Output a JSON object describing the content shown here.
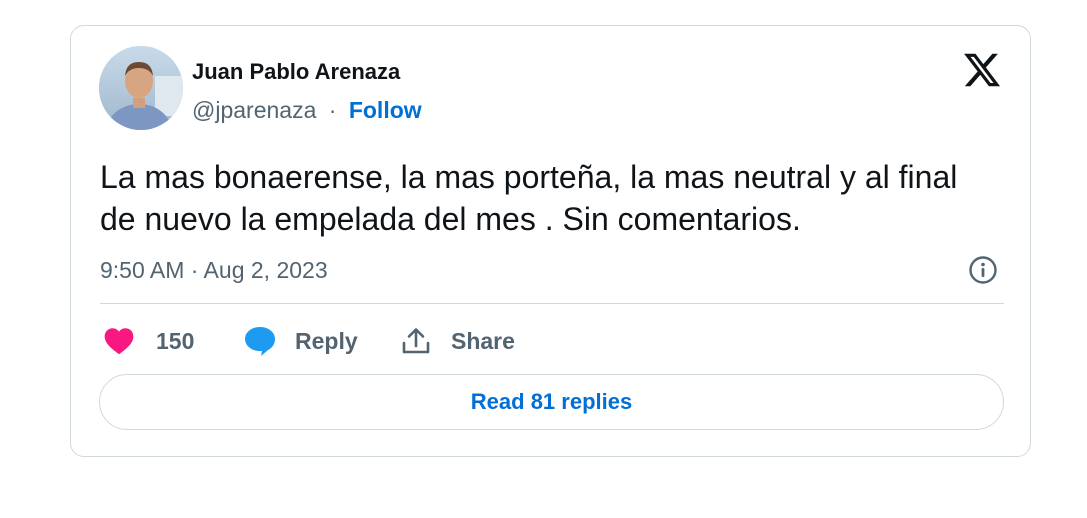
{
  "author": {
    "name": "Juan Pablo Arenaza",
    "handle": "@jparenaza",
    "separator": "·",
    "follow_label": "Follow"
  },
  "tweet": {
    "text": "La mas bonaerense, la mas porteña, la mas neutral y al final de nuevo la empelada del mes . Sin comentarios.",
    "timestamp": "9:50 AM · Aug 2, 2023"
  },
  "actions": {
    "like_count": "150",
    "reply_label": "Reply",
    "share_label": "Share"
  },
  "footer": {
    "read_replies_label": "Read 81 replies"
  },
  "icons": {
    "brand": "x-logo-icon",
    "info": "info-icon",
    "like": "heart-icon",
    "reply": "speech-bubble-icon",
    "share": "share-icon"
  },
  "colors": {
    "accent": "#006fd6",
    "heart": "#f91880",
    "reply_bubble": "#1d9bf0",
    "muted_text": "#536471",
    "border": "#cfd9de"
  }
}
